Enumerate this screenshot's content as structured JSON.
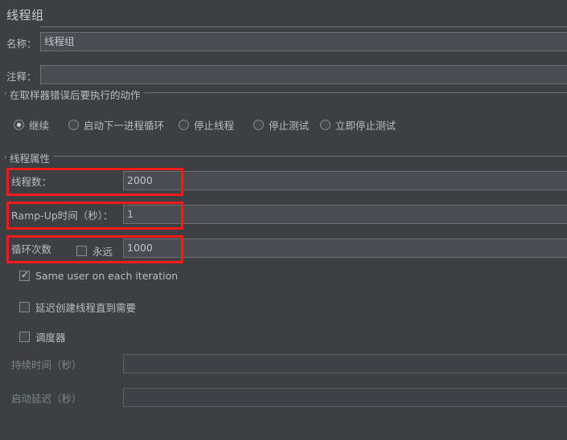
{
  "header": {
    "title": "线程组"
  },
  "basic": {
    "name_label": "名称：",
    "name_value": "线程组",
    "comment_label": "注释：",
    "comment_value": ""
  },
  "error_action": {
    "group_title": "在取样器错误后要执行的动作",
    "options": [
      {
        "label": "继续",
        "selected": true
      },
      {
        "label": "启动下一进程循环",
        "selected": false
      },
      {
        "label": "停止线程",
        "selected": false
      },
      {
        "label": "停止测试",
        "selected": false
      },
      {
        "label": "立即停止测试",
        "selected": false
      }
    ]
  },
  "thread_properties": {
    "group_title": "线程属性",
    "threads_label": "线程数：",
    "threads_value": "2000",
    "rampup_label": "Ramp-Up时间（秒）：",
    "rampup_value": "1",
    "loops_label": "循环次数",
    "forever_label": "永远",
    "forever_checked": false,
    "loops_value": "1000",
    "same_user_label": "Same user on each iteration",
    "same_user_checked": true,
    "delay_create_label": "延迟创建线程直到需要",
    "delay_create_checked": false,
    "scheduler_label": "调度器",
    "scheduler_checked": false,
    "duration_label": "持续时间（秒）",
    "duration_value": "",
    "startup_delay_label": "启动延迟（秒）",
    "startup_delay_value": ""
  },
  "annotations": {
    "highlight_color": "#ff1a1a",
    "boxes": [
      "threads-row",
      "rampup-row",
      "loops-row"
    ]
  }
}
